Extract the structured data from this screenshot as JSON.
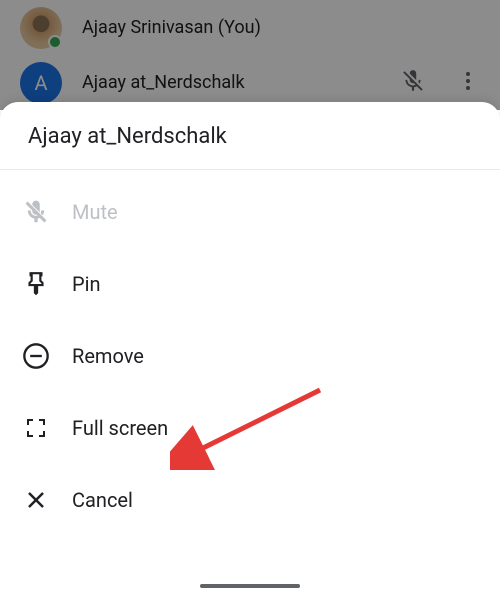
{
  "participants": [
    {
      "name": "Ajaay Srinivasan (You)",
      "avatar_letter": ""
    },
    {
      "name": "Ajaay at_Nerdschalk",
      "avatar_letter": "A"
    }
  ],
  "sheet": {
    "title": "Ajaay at_Nerdschalk"
  },
  "menu": {
    "mute": "Mute",
    "pin": "Pin",
    "remove": "Remove",
    "fullscreen": "Full screen",
    "cancel": "Cancel"
  }
}
